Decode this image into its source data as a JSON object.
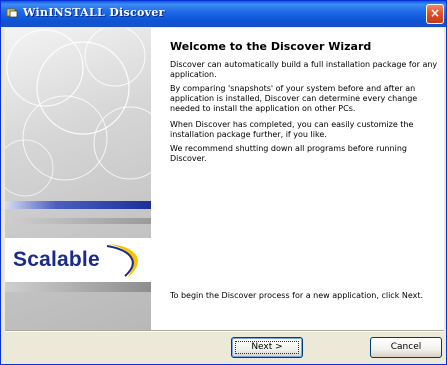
{
  "window": {
    "title": "WinINSTALL Discover",
    "icon": "app-icon",
    "close_label": "×"
  },
  "sidebar": {
    "logo_text": "Scalable"
  },
  "wizard": {
    "heading": "Welcome to the Discover Wizard",
    "paragraphs": [
      "Discover can automatically build a full installation package for any application.",
      "By comparing 'snapshots' of your system before and after an application is installed, Discover can determine every change needed to install the application on other PCs.",
      "When Discover has completed, you can easily customize the installation package further, if you like.",
      "We recommend shutting down all programs before running Discover."
    ],
    "footer_text": "To begin the Discover process for a new application, click Next."
  },
  "buttons": {
    "next_label": "Next >",
    "cancel_label": "Cancel"
  },
  "colors": {
    "titlebar": "#0c54d6",
    "brand_blue": "#1a2b8c",
    "brand_yellow": "#f5c400"
  }
}
